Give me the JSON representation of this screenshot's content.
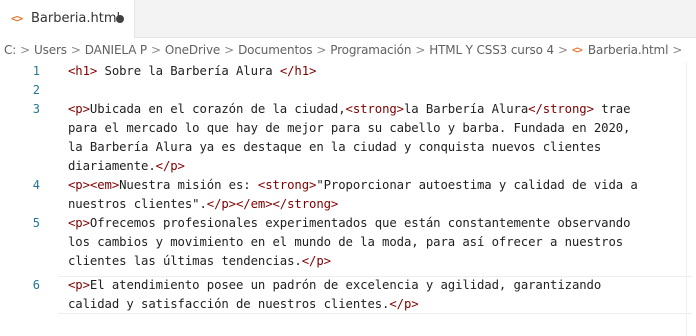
{
  "tab": {
    "icon": "html-file-icon",
    "icon_glyph": "<>",
    "label": "Barberia.html",
    "modified_indicator": "●"
  },
  "breadcrumb": {
    "items": [
      "C:",
      "Users",
      "DANIELA P",
      "OneDrive",
      "Documentos",
      "Programación",
      "HTML Y CSS3 curso 4"
    ],
    "separator": ">",
    "file_icon_glyph": "<>",
    "file": "Barberia.html",
    "trailing_icon": "symbol-icon",
    "trailing_glyph": "⬡"
  },
  "gutter": {
    "line_numbers": [
      "1",
      "2",
      "3",
      "4",
      "5",
      "6"
    ]
  },
  "code": {
    "l1": {
      "a": "<h1>",
      "b": " Sobre la Barbería Alura ",
      "c": "</h1>"
    },
    "l3a": {
      "a": "<p>",
      "b": "Ubicada en el corazón de la ciudad,",
      "c": "<strong>",
      "d": "la Barbería Alura",
      "e": "</strong>",
      "f": " trae"
    },
    "l3b": "para el mercado lo que hay de mejor para su cabello y barba. Fundada en 2020,",
    "l3c": "la Barbería Alura ya es destaque en la ciudad y conquista nuevos clientes",
    "l3d": {
      "a": "diariamente.",
      "b": "</p>"
    },
    "l4a": {
      "a": "<p><em>",
      "b": "Nuestra misión es: ",
      "c": "<strong>",
      "d": "\"Proporcionar autoestima y calidad de vida a"
    },
    "l4b": {
      "a": "nuestros clientes\".",
      "b": "</p></em></strong>"
    },
    "l5a": {
      "a": "<p>",
      "b": "Ofrecemos profesionales experimentados que están constantemente observando"
    },
    "l5b": "los cambios y movimiento en el mundo de la moda, para así ofrecer a nuestros",
    "l5c": {
      "a": "clientes las últimas tendencias.",
      "b": "</p>"
    },
    "l6a": {
      "a": "<p>",
      "b": "El atendimiento posee un padrón de excelencia y agilidad, garantizando"
    },
    "l6b": {
      "a": "calidad y satisfacción de nuestros clientes.",
      "b": "</p>"
    }
  },
  "colors": {
    "tag": "#800000",
    "text": "#1f1f1f",
    "line_number": "#237893",
    "file_icon": "#e37933"
  }
}
